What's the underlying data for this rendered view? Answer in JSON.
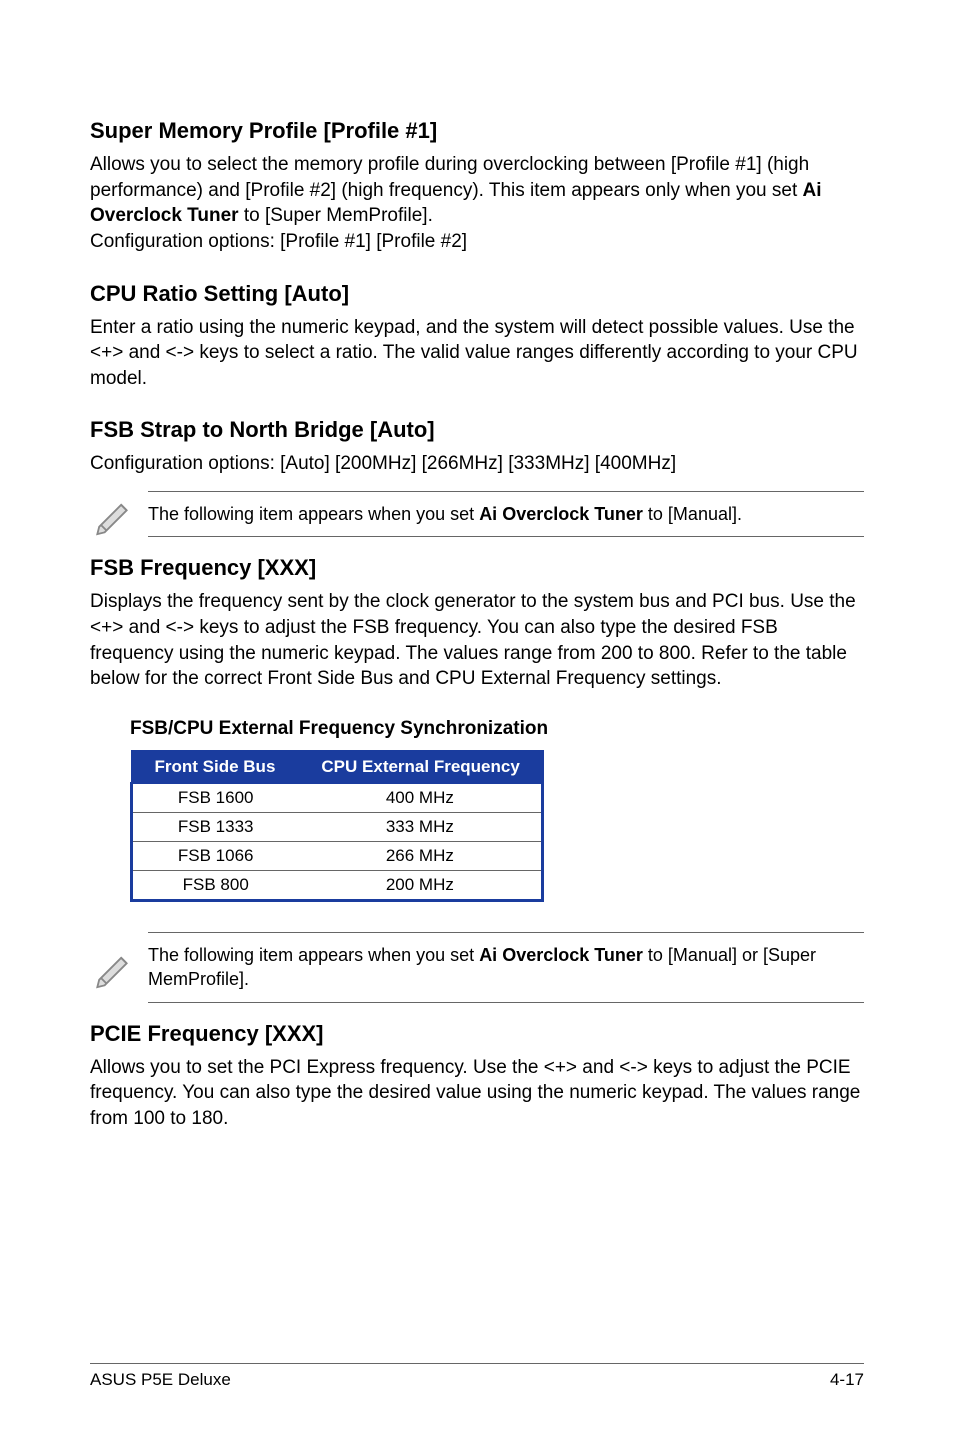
{
  "sections": {
    "s1": {
      "title": "Super Memory Profile [Profile #1]",
      "p1a": "Allows you to select the memory profile during overclocking between [Profile #1] (high performance) and [Profile #2] (high frequency). This item appears only when you set ",
      "p1b": "Ai Overclock Tuner",
      "p1c": " to [Super MemProfile].",
      "p2": "Configuration options: [Profile #1] [Profile #2]"
    },
    "s2": {
      "title": "CPU Ratio Setting [Auto]",
      "p1": "Enter a ratio using the numeric keypad, and the system will detect possible values. Use the <+> and <-> keys to select a ratio. The valid value ranges differently according to your CPU model."
    },
    "s3": {
      "title": "FSB Strap to North Bridge [Auto]",
      "p1": "Configuration options: [Auto] [200MHz] [266MHz] [333MHz] [400MHz]"
    },
    "note1": {
      "a": "The following item appears when you set ",
      "b": "Ai Overclock Tuner",
      "c": " to [Manual]."
    },
    "s4": {
      "title": "FSB Frequency [XXX]",
      "p1": "Displays the frequency sent by the clock generator to the system bus and PCI bus. Use the <+> and <-> keys to adjust the FSB frequency. You can also type the desired FSB frequency using the numeric keypad. The values range from 200 to 800. Refer to the table below for the correct Front Side Bus and CPU External Frequency settings."
    },
    "table": {
      "caption": "FSB/CPU External Frequency Synchronization",
      "headers": {
        "h1": "Front Side Bus",
        "h2": "CPU External Frequency"
      },
      "rows": [
        {
          "c1": "FSB 1600",
          "c2": "400 MHz"
        },
        {
          "c1": "FSB 1333",
          "c2": "333 MHz"
        },
        {
          "c1": "FSB 1066",
          "c2": "266 MHz"
        },
        {
          "c1": "FSB 800",
          "c2": "200 MHz"
        }
      ]
    },
    "note2": {
      "a": "The following item appears when you set ",
      "b": "Ai Overclock Tuner",
      "c": " to [Manual] or [Super MemProfile]."
    },
    "s5": {
      "title": "PCIE Frequency [XXX]",
      "p1": "Allows you to set the PCI Express frequency. Use the <+> and <-> keys to adjust the PCIE frequency. You can also type the desired value using the numeric keypad. The values range from 100 to 180."
    }
  },
  "footer": {
    "left": "ASUS P5E Deluxe",
    "right": "4-17"
  }
}
